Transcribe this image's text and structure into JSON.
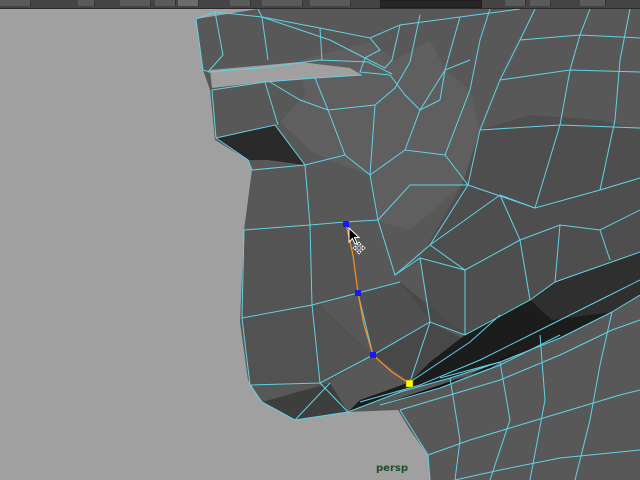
{
  "viewport": {
    "camera_label": "persp",
    "background_color": "#a0a0a0",
    "wire_color": "#5fd3e6",
    "edge_loop_color": "#ff8c1a",
    "vertex_selected_color": "#1818ff",
    "vertex_active_color": "#ffff00"
  },
  "toolbar": {
    "icons": [
      "tool-icon",
      "tool-icon",
      "snap-icon",
      "snap-icon",
      "magnet-icon",
      "render-icon",
      "render-icon",
      "display-icon"
    ]
  },
  "cursor": {
    "primary": "arrow-pointer-icon",
    "secondary": "move-cross-icon"
  }
}
